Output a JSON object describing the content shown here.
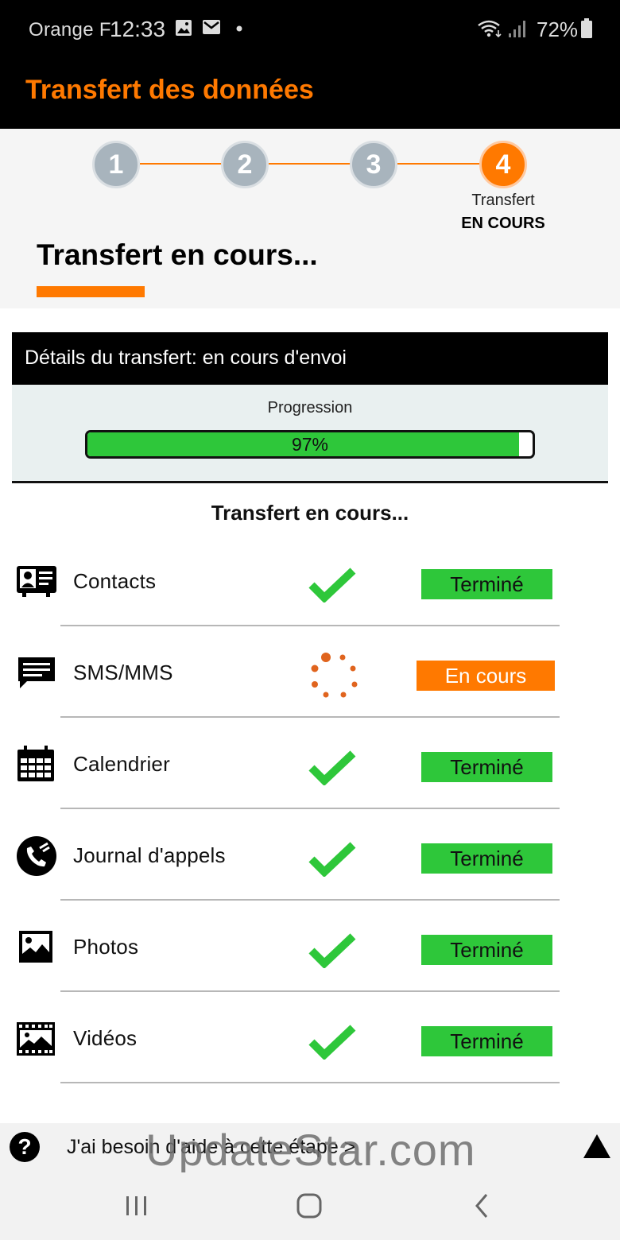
{
  "status_bar": {
    "carrier": "Orange F",
    "time": "12:33",
    "battery": "72%",
    "icons": [
      "image-icon",
      "mail-icon",
      "dot-icon",
      "wifi-icon",
      "signal-icon",
      "battery-icon"
    ]
  },
  "header": {
    "title": "Transfert des données",
    "accent_color": "#ff7900"
  },
  "stepper": {
    "steps": [
      {
        "number": "1",
        "state": "done"
      },
      {
        "number": "2",
        "state": "done"
      },
      {
        "number": "3",
        "state": "done"
      },
      {
        "number": "4",
        "state": "active"
      }
    ],
    "active_caption": "Transfert",
    "active_status": "EN COURS"
  },
  "page": {
    "title": "Transfert en cours..."
  },
  "details": {
    "header": "Détails du transfert: en cours d'envoi",
    "progress_label": "Progression",
    "progress_value": 97,
    "progress_text": "97%",
    "progress_color": "#2ec73a"
  },
  "list": {
    "title": "Transfert en cours...",
    "items": [
      {
        "label": "Contacts",
        "icon": "contact-card-icon",
        "status": "Terminé",
        "state": "done"
      },
      {
        "label": "SMS/MMS",
        "icon": "message-icon",
        "status": "En cours",
        "state": "progress"
      },
      {
        "label": "Calendrier",
        "icon": "calendar-icon",
        "status": "Terminé",
        "state": "done"
      },
      {
        "label": "Journal d'appels",
        "icon": "call-log-icon",
        "status": "Terminé",
        "state": "done"
      },
      {
        "label": "Photos",
        "icon": "photo-icon",
        "status": "Terminé",
        "state": "done"
      },
      {
        "label": "Vidéos",
        "icon": "video-icon",
        "status": "Terminé",
        "state": "done"
      }
    ]
  },
  "help": {
    "text": "J'ai besoin d'aide à cette étape >"
  },
  "watermark": "UpdateStar.com"
}
